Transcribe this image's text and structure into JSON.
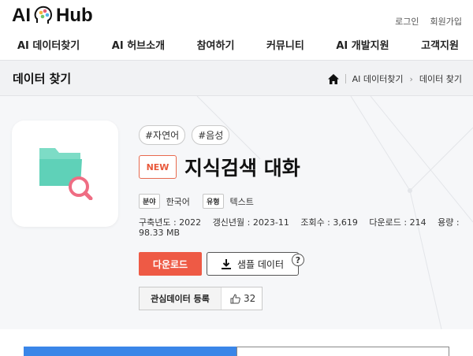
{
  "header": {
    "logo_left": "AI",
    "logo_right": "Hub",
    "util_links": [
      "로그인",
      "회원가입"
    ]
  },
  "nav": [
    "AI 데이터찾기",
    "AI 허브소개",
    "참여하기",
    "커뮤니티",
    "AI 개발지원",
    "고객지원"
  ],
  "subheader": {
    "title": "데이터 찾기",
    "breadcrumb": [
      "AI 데이터찾기",
      "데이터 찾기"
    ]
  },
  "dataset": {
    "tags": [
      "#자연어",
      "#음성"
    ],
    "badge": "NEW",
    "title": "지식검색 대화",
    "field_label": "분야",
    "field_value": "한국어",
    "type_label": "유형",
    "type_value": "텍스트",
    "stats": [
      "구축년도 : 2022",
      "갱신년월 : 2023-11",
      "조회수 : 3,619",
      "다운로드 : 214",
      "용량 : 98.33 MB"
    ],
    "download_label": "다운로드",
    "sample_label": "샘플 데이터",
    "help": "?",
    "fav_label": "관심데이터 등록",
    "likes": "32"
  },
  "colors": {
    "accent": "#ee5a45",
    "tab_blue": "#3a86e8",
    "folder": "#5fd1b8",
    "magnifier": "#ef6d83"
  }
}
